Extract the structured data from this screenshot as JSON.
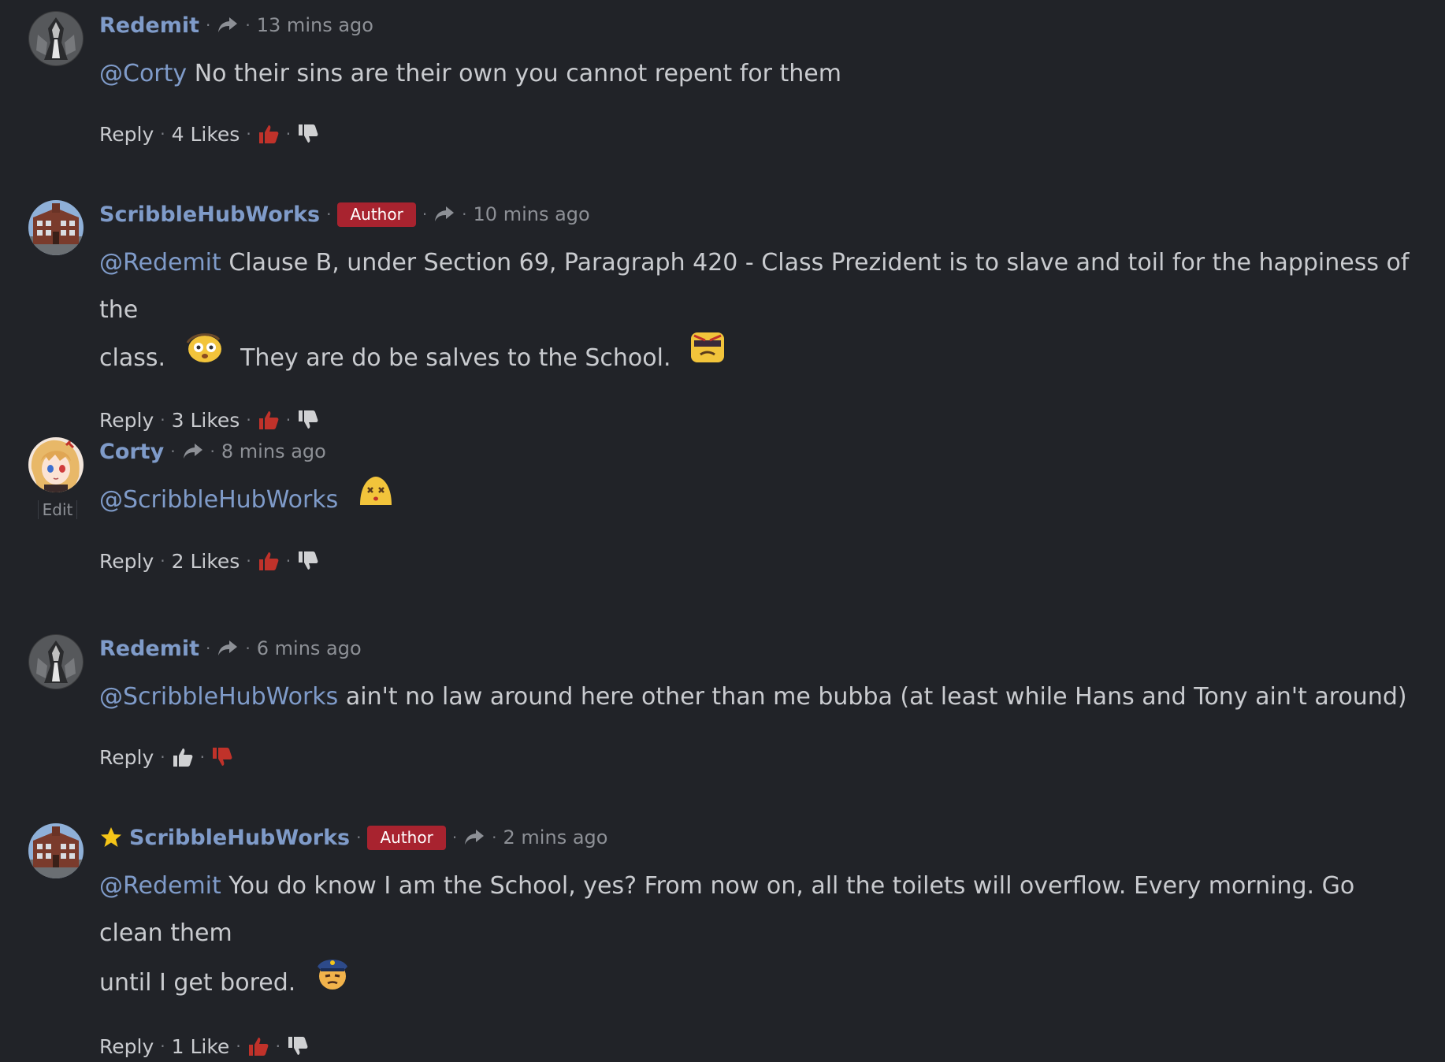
{
  "colors": {
    "background": "#212328",
    "username": "#7f9bc9",
    "mention": "#7f9bc9",
    "author_badge": "#a8232f",
    "like_active": "#c0322a",
    "dislike_active": "#c0322a",
    "text": "#c9cbcf",
    "muted": "#8d9096"
  },
  "separator": "·",
  "comments": [
    {
      "username": "Redemit",
      "badge": "",
      "timestamp": "13 mins ago",
      "mention": "@Corty",
      "text_parts": [
        "No their sins are their own you cannot repent for them"
      ],
      "reply_label": "Reply",
      "likes": "4 Likes",
      "liked": true,
      "avatar_icon": "armored-figure-avatar"
    },
    {
      "username": "ScribbleHubWorks",
      "badge": "Author",
      "timestamp": "10 mins ago",
      "mention": "@Redemit",
      "text_parts": [
        "Clause B, under Section 69, Paragraph 420 - Class Prezident is to slave and toil for the happiness of the",
        "class.",
        "They are do be salves to the School."
      ],
      "emojis": [
        "flushed-face-emoji",
        "angry-sunglasses-emoji"
      ],
      "reply_label": "Reply",
      "likes": "3 Likes",
      "liked": true,
      "avatar_icon": "school-building-avatar"
    },
    {
      "username": "Corty",
      "badge": "",
      "timestamp": "8 mins ago",
      "mention": "@ScribbleHubWorks",
      "text_parts": [],
      "emojis": [
        "dizzy-face-emoji"
      ],
      "edit_label": "Edit",
      "reply_label": "Reply",
      "likes": "2 Likes",
      "liked": true,
      "avatar_icon": "anime-girl-avatar"
    },
    {
      "username": "Redemit",
      "badge": "",
      "timestamp": "6 mins ago",
      "mention": "@ScribbleHubWorks",
      "text_parts": [
        "ain't no law around here other than me bubba (at least while Hans and Tony ain't around)"
      ],
      "reply_label": "Reply",
      "likes": "",
      "liked": false,
      "disliked": true,
      "avatar_icon": "armored-figure-avatar"
    },
    {
      "username": "ScribbleHubWorks",
      "badge": "Author",
      "timestamp": "2 mins ago",
      "mention": "@Redemit",
      "text_parts": [
        "You do know I am the School, yes? From now on, all the toilets will overflow. Every morning. Go clean them",
        "until I get bored."
      ],
      "emojis": [
        "police-officer-emoji"
      ],
      "starred": true,
      "reply_label": "Reply",
      "likes": "1 Like",
      "liked": true,
      "avatar_icon": "school-building-avatar"
    }
  ]
}
